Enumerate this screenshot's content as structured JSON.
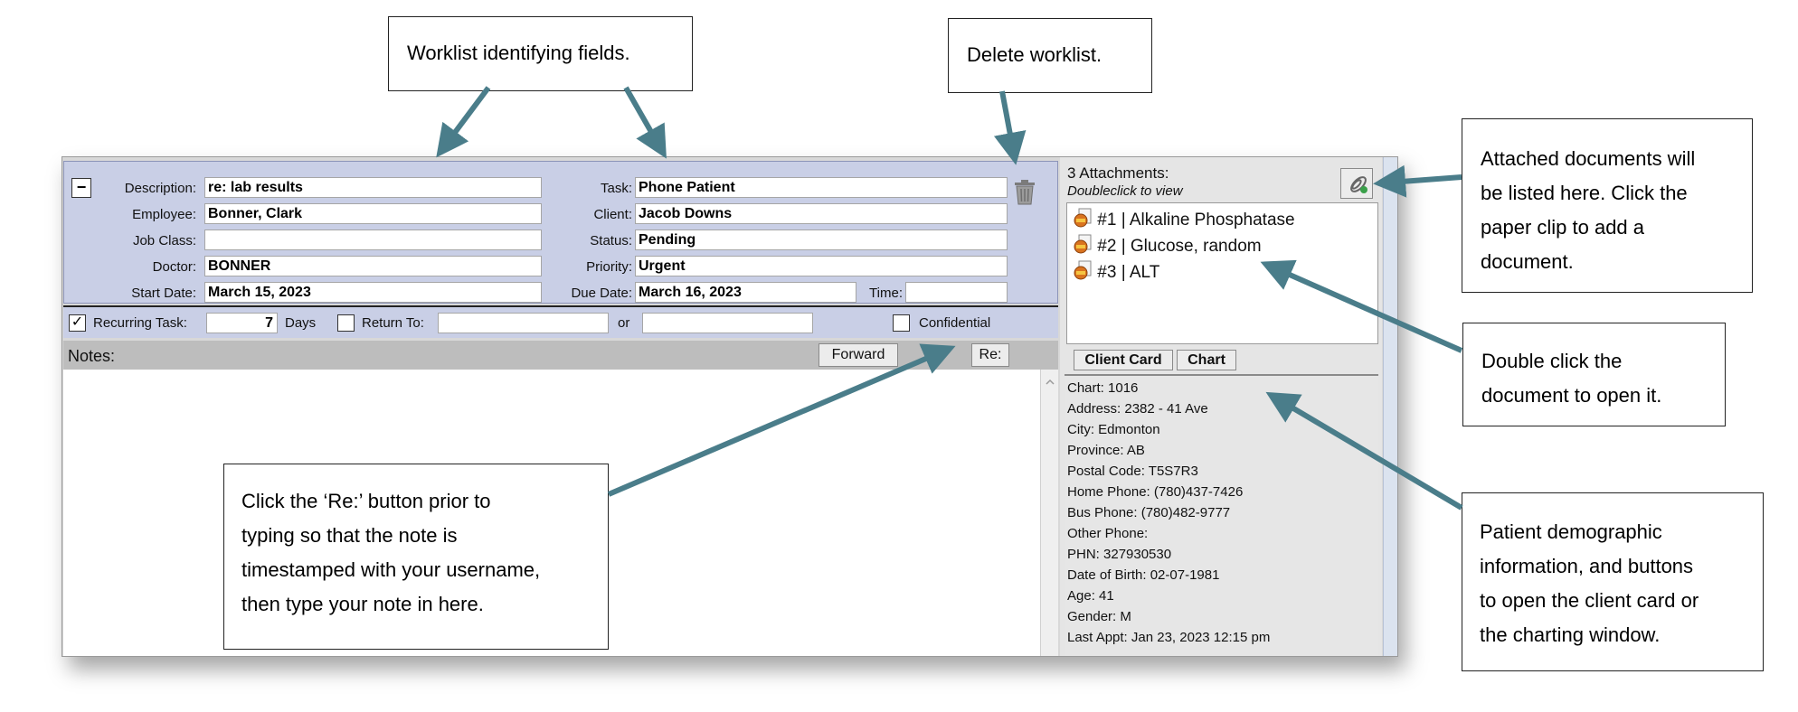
{
  "colors": {
    "header_bg": "#c9cfe6",
    "arrow": "#4a7d8a",
    "panel_bg": "#e5e5e5"
  },
  "callouts": {
    "worklist_fields": "Worklist identifying fields.",
    "delete": "Delete worklist.",
    "attached": "Attached documents will\nbe listed here. Click the\npaper clip to add a\ndocument.",
    "doubleclick": "Double click the\ndocument to open it.",
    "demographic": "Patient demographic\ninformation, and buttons\nto open the client card or\nthe charting window.",
    "re_button": "Click the ‘Re:’ button prior to\ntyping so that the note is\ntimestamped with your username,\nthen type your note in here."
  },
  "worklist": {
    "collapse": "−",
    "labels": {
      "description": "Description:",
      "employee": "Employee:",
      "job_class": "Job Class:",
      "doctor": "Doctor:",
      "start_date": "Start Date:",
      "task": "Task:",
      "client": "Client:",
      "status": "Status:",
      "priority": "Priority:",
      "due_date": "Due Date:",
      "time": "Time:"
    },
    "values": {
      "description": "re: lab results",
      "employee": "Bonner, Clark",
      "job_class": "",
      "doctor": "BONNER",
      "start_date": "March 15, 2023",
      "task": "Phone Patient",
      "client": "Jacob Downs",
      "status": "Pending",
      "priority": "Urgent",
      "due_date": "March 16, 2023",
      "time": ""
    },
    "trash_icon": "trash-icon"
  },
  "recurring": {
    "checked": true,
    "label": "Recurring Task:",
    "days_value": "7",
    "days_label": "Days",
    "return_checked": false,
    "return_label": "Return To:",
    "return_value": "",
    "or_label": "or",
    "or_value": "",
    "confidential_checked": false,
    "confidential_label": "Confidential"
  },
  "notes": {
    "label": "Notes:",
    "forward_button": "Forward",
    "re_button": "Re:",
    "text": ""
  },
  "attachments": {
    "count_label": "3 Attachments:",
    "hint": "Doubleclick to view",
    "items": [
      {
        "label": "#1 | Alkaline Phosphatase"
      },
      {
        "label": "#2 | Glucose, random"
      },
      {
        "label": "#3 | ALT"
      }
    ],
    "paperclip_icon": "paperclip-icon"
  },
  "client": {
    "client_card_button": "Client Card",
    "chart_button": "Chart",
    "lines": [
      "Chart: 1016",
      "Address: 2382 - 41 Ave",
      "City: Edmonton",
      "Province: AB",
      "Postal Code: T5S7R3",
      "Home Phone: (780)437-7426",
      "Bus Phone: (780)482-9777",
      "Other Phone:",
      "PHN: 327930530",
      "Date of Birth: 02-07-1981",
      "Age: 41",
      "Gender: M",
      "Last Appt: Jan 23, 2023 12:15 pm"
    ]
  }
}
